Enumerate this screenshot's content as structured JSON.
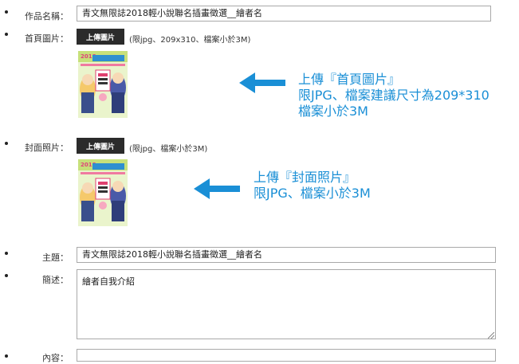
{
  "fields": {
    "work_name_label": "作品名稱：",
    "work_name_value": "青文無限誌2018輕小說聯名插畫徵選__繪者名",
    "cover_image_label": "首頁圖片：",
    "cover_upload_button": "上傳圖片",
    "cover_hint": "(限jpg、209x310、檔案小於3M)",
    "front_image_label": "封面照片：",
    "front_upload_button": "上傳圖片",
    "front_hint": "(限jpg、檔案小於3M)",
    "subject_label": "主題：",
    "subject_value": "青文無限誌2018輕小說聯名插畫徵選__繪者名",
    "description_label": "簡述：",
    "description_value": "繪者自我介紹",
    "content_label": "內容："
  },
  "thumbnail": {
    "year": "2018"
  },
  "annotations": {
    "cover_note_line1": "上傳『首頁圖片』",
    "cover_note_line2": "限JPG、檔案建議尺寸為209*310",
    "cover_note_line3": "檔案小於3M",
    "front_note_line1": "上傳『封面照片』",
    "front_note_line2": "限JPG、檔案小於3M"
  },
  "colors": {
    "annotation_blue": "#1a8fd6",
    "button_dark": "#2b2b2b"
  }
}
